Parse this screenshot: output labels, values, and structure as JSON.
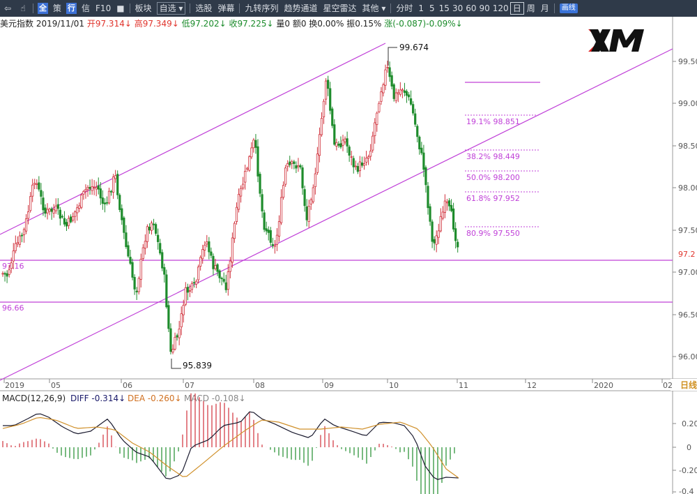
{
  "toolbar": {
    "back_icon": "back-arrow-icon",
    "hand_icon": "hand-icon",
    "quan": "全",
    "ce": "策",
    "hang": "行",
    "xin": "信",
    "f10": "F10",
    "bankuai": "板块",
    "zixuan": "自选",
    "xuangu": "选股",
    "danmu": "弹幕",
    "jiuzhuan": "九转序列",
    "qushi": "趋势通道",
    "xingkong": "星空雷达",
    "qita": "其他",
    "periods": [
      "分时",
      "1",
      "5",
      "15",
      "30",
      "60",
      "90",
      "120",
      "日",
      "周",
      "月"
    ],
    "huaxian": "画线"
  },
  "info": {
    "name": "美元指数",
    "date": "2019/11/01",
    "open": "开97.314↓",
    "high": "高97.349↓",
    "low": "低97.202↓",
    "close": "收97.225↓",
    "vol": "量0",
    "amount": "额0",
    "turnover": "换0.00%",
    "amplitude": "振0.15%",
    "change": "涨(-0.087)-0.09%↓"
  },
  "price_axis": {
    "ticks": [
      "99.50",
      "99.00",
      "98.50",
      "98.00",
      "97.50",
      "97.00",
      "96.50",
      "96.00"
    ],
    "current": "97.2"
  },
  "time_axis": {
    "labels": [
      "2019",
      "05",
      "06",
      "07",
      "08",
      "09",
      "10",
      "11",
      "12",
      "2020",
      "02"
    ],
    "period_label": "日线"
  },
  "annotations": {
    "high": "99.674",
    "low": "95.839",
    "level_left_1": "97.16",
    "level_left_2": "96.66"
  },
  "fib": [
    "19.1% 98.851",
    "38.2% 98.449",
    "50.0% 98.200",
    "61.8% 97.952",
    "80.9% 97.550"
  ],
  "macd": {
    "title": "MACD(12,26,9)",
    "diff": "DIFF -0.314↓",
    "dea": "DEA -0.260↓",
    "macd": "MACD -0.108↓",
    "ticks": [
      "0.20",
      "0",
      "-0.20",
      "-0.4"
    ]
  },
  "colors": {
    "up": "#d0303a",
    "down": "#1e8c2c",
    "trendline": "#c040d8",
    "diff": "#1a1a2e",
    "dea": "#d0902a"
  },
  "chart_data": {
    "type": "candlestick",
    "title": "美元指数",
    "ylim": [
      95.75,
      99.85
    ],
    "high": 99.674,
    "low": 95.839
  }
}
